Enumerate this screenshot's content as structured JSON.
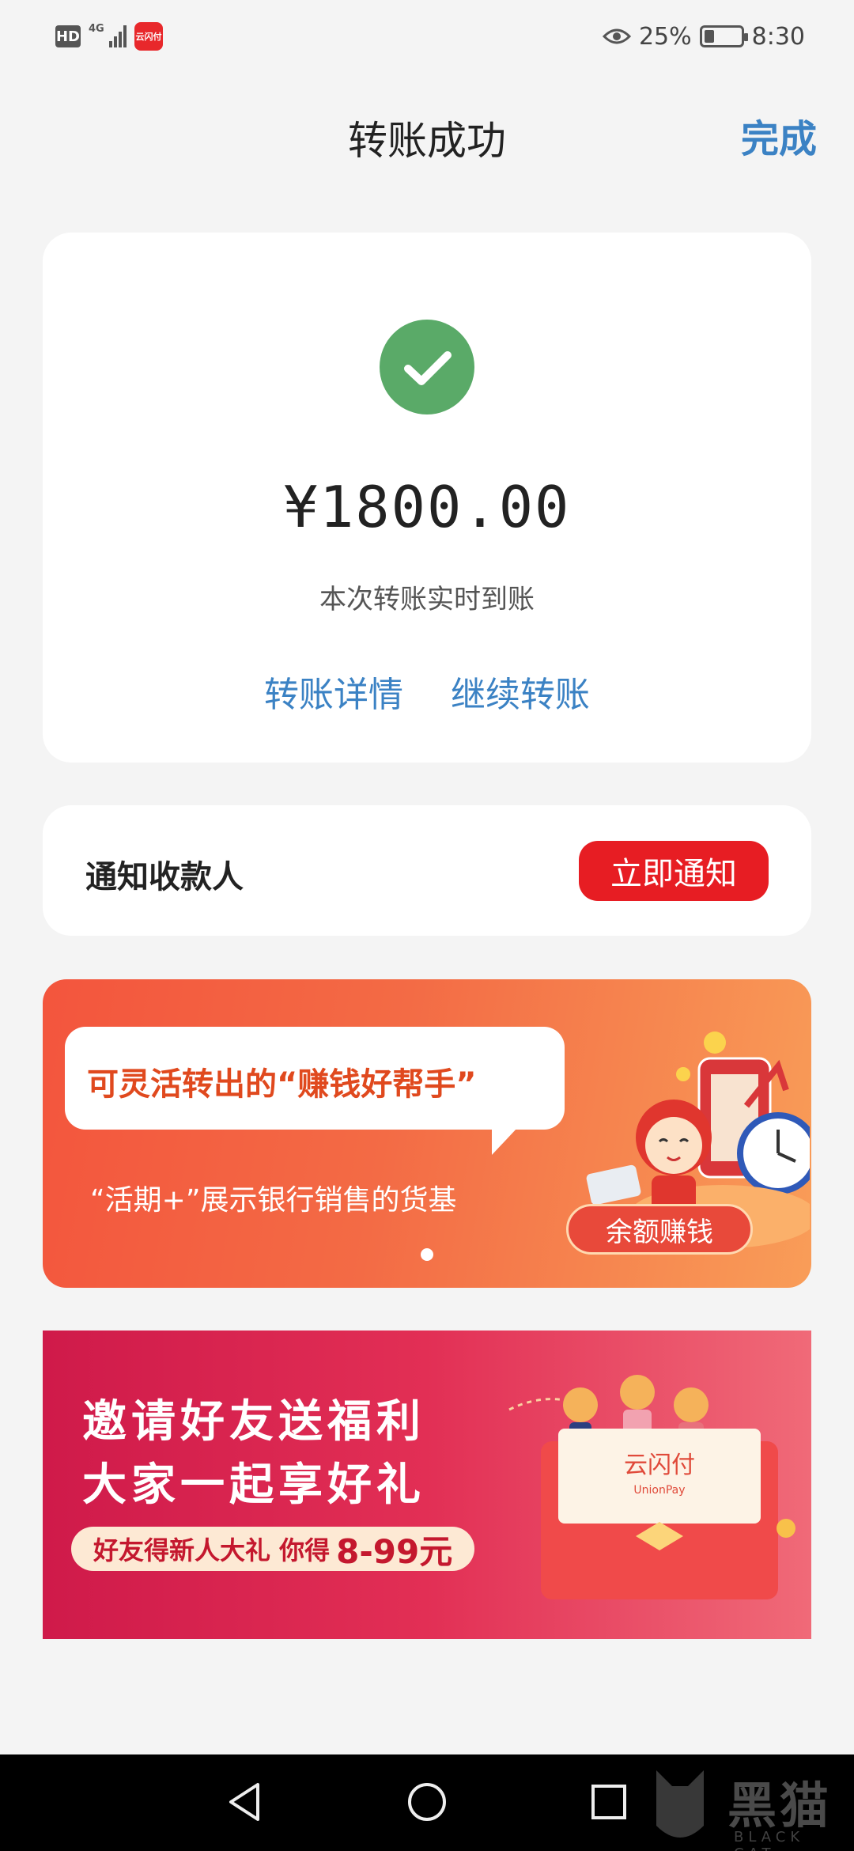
{
  "status_bar": {
    "hd_badge": "HD",
    "network": "4G",
    "app_icon_text": "云闪付",
    "battery": "25%",
    "time": "8:30"
  },
  "header": {
    "title": "转账成功",
    "done_label": "完成"
  },
  "result": {
    "amount": "¥1800.00",
    "message": "本次转账实时到账",
    "detail_link": "转账详情",
    "continue_link": "继续转账",
    "success_color": "#5aaa68"
  },
  "notify": {
    "label": "通知收款人",
    "button": "立即通知"
  },
  "banner1": {
    "headline": "可灵活转出的“赚钱好帮手”",
    "subtitle": "“活期+”展示银行销售的货基",
    "button": "余额赚钱"
  },
  "banner2": {
    "line1": "邀请好友送福利",
    "line2": "大家一起享好礼",
    "pill_text": "好友得新人大礼 你得",
    "pill_amount": "8-99元",
    "envelope_brand": "云闪付",
    "envelope_sub": "UnionPay"
  },
  "watermark": {
    "text": "黑猫",
    "sub": "BLACK CAT"
  },
  "colors": {
    "accent_blue": "#3b82c4",
    "notify_red": "#e71d23"
  }
}
